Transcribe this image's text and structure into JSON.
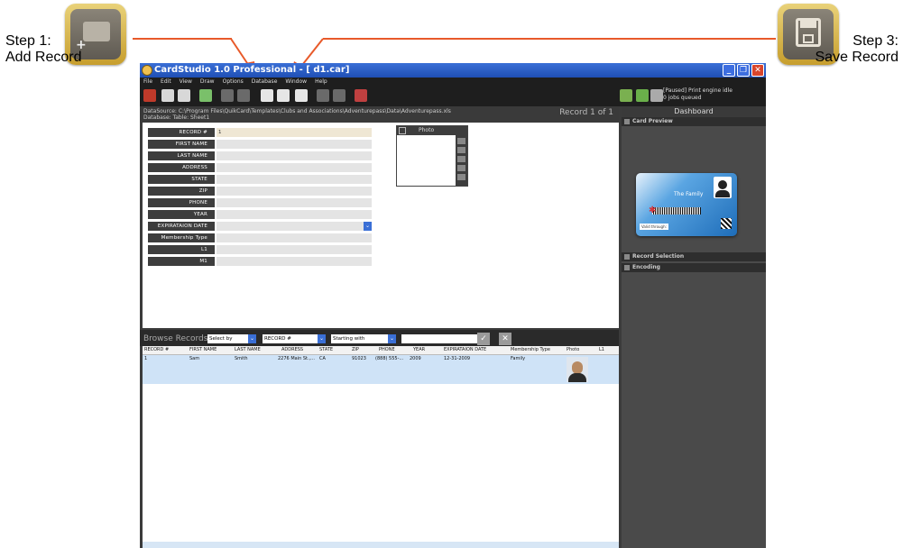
{
  "callouts": {
    "step1_line1": "Step 1:",
    "step1_line2": "Add Record",
    "step3_line1": "Step 3:",
    "step3_line2": "Save Record",
    "accent": "#e85a2a"
  },
  "window": {
    "title": "CardStudio 1.0 Professional - [     d1.car]",
    "menus": [
      "File",
      "Edit",
      "View",
      "Draw",
      "Options",
      "Database",
      "Window",
      "Help"
    ],
    "status_line1": "[Paused] Print engine idle",
    "status_line2": "0 jobs queued"
  },
  "datasource": {
    "line1": "DataSource: C:\\Program Files\\QuikCard\\Templates\\Clubs and Associations\\Adventurepass\\Data\\Adventurepass.xls",
    "line2": "Database:     Table: Sheet1",
    "record_of": "Record 1 of 1"
  },
  "form": {
    "fields": [
      {
        "label": "RECORD #",
        "value": "1"
      },
      {
        "label": "FIRST NAME",
        "value": ""
      },
      {
        "label": "LAST NAME",
        "value": ""
      },
      {
        "label": "ADDRESS",
        "value": ""
      },
      {
        "label": "STATE",
        "value": ""
      },
      {
        "label": "ZIP",
        "value": ""
      },
      {
        "label": "PHONE",
        "value": ""
      },
      {
        "label": "YEAR",
        "value": ""
      },
      {
        "label": "EXPIRATAION DATE",
        "value": ""
      },
      {
        "label": "Membership Type",
        "value": ""
      },
      {
        "label": "L1",
        "value": ""
      },
      {
        "label": "M1",
        "value": ""
      }
    ],
    "photo_label": "Photo"
  },
  "browse": {
    "title": "Browse Records",
    "select_by": "Select by",
    "field": "RECORD #",
    "mode": "Starting with",
    "search": "",
    "columns": [
      "RECORD #",
      "FIRST NAME",
      "LAST NAME",
      "ADDRESS",
      "STATE",
      "ZIP",
      "PHONE",
      "YEAR",
      "EXPIRATAION DATE",
      "Membership Type",
      "Photo",
      "L1"
    ],
    "rows": [
      [
        "1",
        "Sam",
        "Smith",
        "2276 Main St.,...",
        "CA",
        "91023",
        "(888) 555-...",
        "2009",
        "12-31-2009",
        "Family",
        "",
        ""
      ]
    ]
  },
  "dashboard": {
    "title": "Dashboard",
    "card_preview": "Card Preview",
    "record_selection": "Record Selection",
    "encoding": "Encoding",
    "card_family": "The Family",
    "card_footer": "Valid through:"
  }
}
